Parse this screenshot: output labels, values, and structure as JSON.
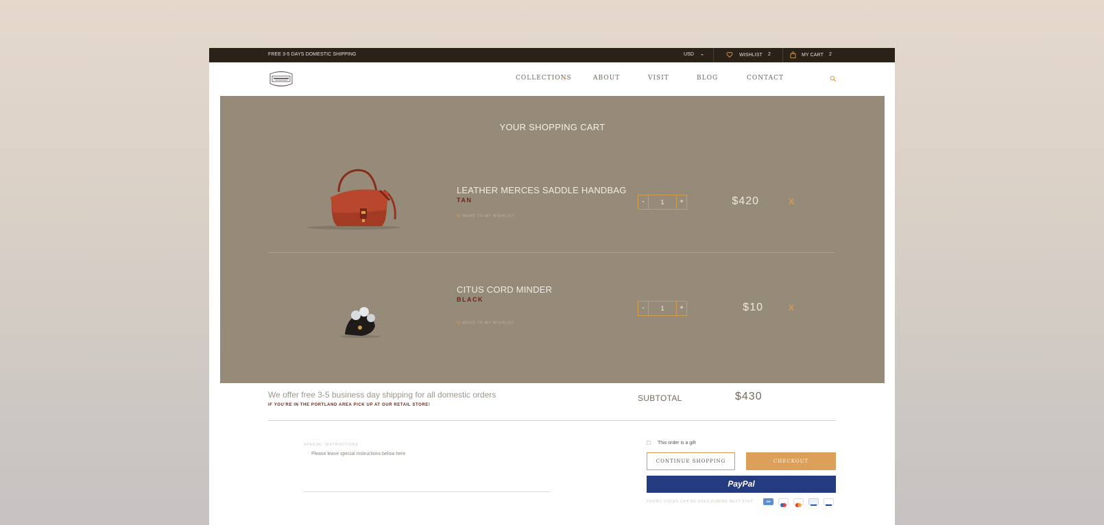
{
  "topbar": {
    "shipping_notice": "FREE 3-5 DAYS DOMESTIC SHIPPING",
    "currency": "USD",
    "wishlist_label": "WISHLIST",
    "wishlist_count": "2",
    "cart_label": "MY CART",
    "cart_count": "2"
  },
  "nav": {
    "items": [
      {
        "label": "COLLECTIONS"
      },
      {
        "label": "ABOUT"
      },
      {
        "label": "VISIT"
      },
      {
        "label": "BLOG"
      },
      {
        "label": "CONTACT"
      }
    ],
    "icons": {
      "search": "search-icon",
      "wishlist": "heart-icon",
      "cart": "bag-icon"
    }
  },
  "cart": {
    "title": "YOUR SHOPPING CART",
    "items": [
      {
        "name": "LEATHER MERCES SADDLE HANDBAG",
        "color": "TAN",
        "wishlist_link": "MOVE TO MY WISHLIST",
        "quantity": "1",
        "price": "$420",
        "remove": "X"
      },
      {
        "name": "CITUS CORD MINDER",
        "color": "BLACK",
        "wishlist_link": "MOVE TO MY WISHLIST",
        "quantity": "1",
        "price": "$10",
        "remove": "X"
      }
    ],
    "qty_minus": "-",
    "qty_plus": "+"
  },
  "summary": {
    "shipping_offer": "We offer free  3-5 business day shipping for all domestic orders",
    "pickup_note": "IF YOU'RE IN THE PORTLAND AREA PICK UP AT OUR RETAIL STORE!",
    "subtotal_label": "SUBTOTAL",
    "subtotal_value": "$430"
  },
  "checkout": {
    "special_instructions_label": "SPECIAL INSTRUCTIONS",
    "special_instructions_placeholder": "Please leave special instructions below here",
    "gift_label": "This order is a gift",
    "continue_label": "CONTINUE SHOPPING",
    "checkout_label": "CHECKOUT",
    "paypal_label": "PayPal",
    "promo_note": "PROMO CODES CAN BE USED DURING NEXT STEP"
  },
  "colors": {
    "accent": "#d49a50",
    "panel": "#968b79",
    "topbar": "#2a2119",
    "paypal": "#253b80",
    "product_color_text": "#6e2416"
  }
}
